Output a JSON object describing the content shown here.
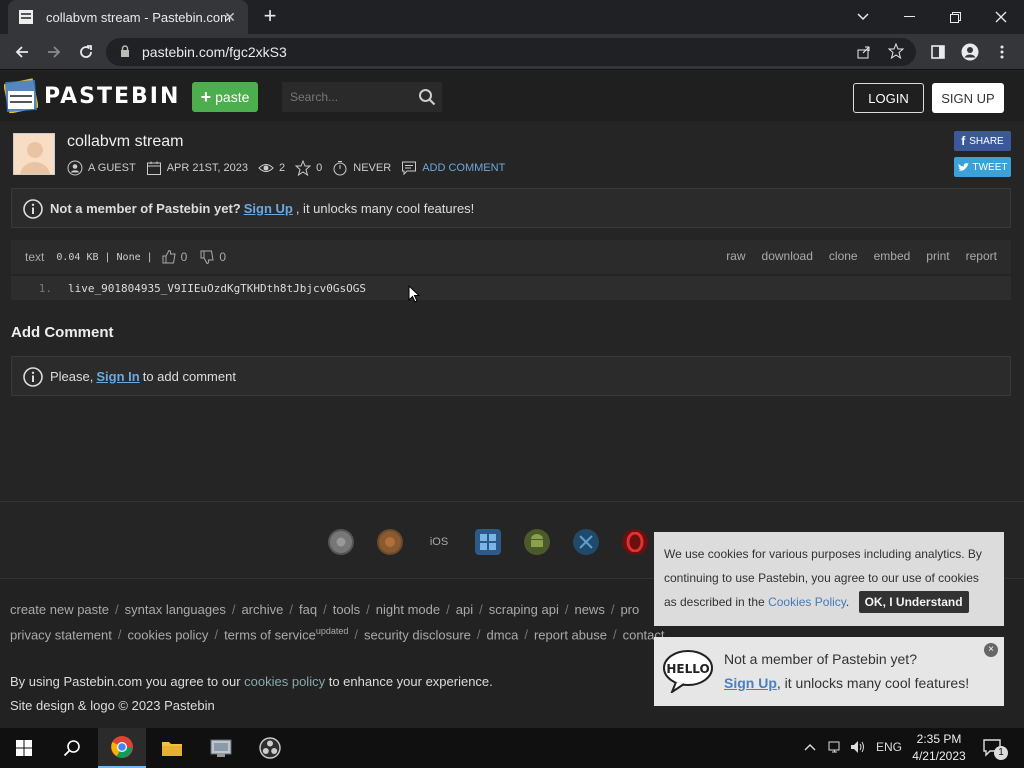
{
  "browser": {
    "tab_title": "collabvm stream - Pastebin.com",
    "tab_close": "✕",
    "new_tab": "+",
    "url": "pastebin.com/fgc2xkS3"
  },
  "header": {
    "logo_text": "PASTEBIN",
    "paste_label": "paste",
    "search_placeholder": "Search...",
    "login_label": "LOGIN",
    "signup_label": "SIGN UP"
  },
  "paste": {
    "title": "collabvm stream",
    "author": "A GUEST",
    "date": "APR 21ST, 2023",
    "views": "2",
    "stars": "0",
    "expiry": "NEVER",
    "add_comment": "ADD COMMENT",
    "share_label": "SHARE",
    "tweet_label": "TWEET"
  },
  "notice_member": {
    "lead": "Not a member of Pastebin yet?",
    "link": "Sign Up",
    "tail": ", it unlocks many cool features!"
  },
  "codebar": {
    "syntax": "text",
    "size": "0.04 KB",
    "category": "None",
    "pipe": "|",
    "likes": "0",
    "dislikes": "0",
    "actions": [
      "raw",
      "download",
      "clone",
      "embed",
      "print",
      "report"
    ]
  },
  "code": {
    "line_number": "1.",
    "line_text": "live_901804935_V9IIEuOzdKgTKHDth8tJbjcv0GsOGS"
  },
  "comments": {
    "heading": "Add Comment",
    "lead": "Please,",
    "link": "Sign In",
    "tail": "to add comment"
  },
  "footer": {
    "ios_label": "iOS",
    "links_row1": [
      "create new paste",
      "syntax languages",
      "archive",
      "faq",
      "tools",
      "night mode",
      "api",
      "scraping api",
      "news",
      "pro"
    ],
    "links_row2": [
      "privacy statement",
      "cookies policy",
      "terms of service",
      "security disclosure",
      "dmca",
      "report abuse",
      "contact"
    ],
    "tos_sup": "updated",
    "sep": "/",
    "agree_lead": "By using Pastebin.com you agree to our",
    "agree_link": "cookies policy",
    "agree_tail": "to enhance your experience.",
    "copyright": "Site design & logo © 2023 Pastebin"
  },
  "cookie": {
    "text": "We use cookies for various purposes including analytics. By continuing to use Pastebin, you agree to our use of cookies as described in the",
    "link": "Cookies Policy",
    "dot": ".",
    "ok": "OK, I Understand"
  },
  "hello_popup": {
    "line1": "Not a member of Pastebin yet?",
    "link": "Sign Up",
    "tail": ", it unlocks many cool features!",
    "close": "×"
  },
  "taskbar": {
    "lang": "ENG",
    "time": "2:35 PM",
    "date": "4/21/2023",
    "notif_count": "1"
  },
  "colors": {
    "accent_green": "#4cae4c",
    "link_blue": "#6ea8dc",
    "facebook": "#3b5998",
    "twitter": "#3ba1d9"
  }
}
